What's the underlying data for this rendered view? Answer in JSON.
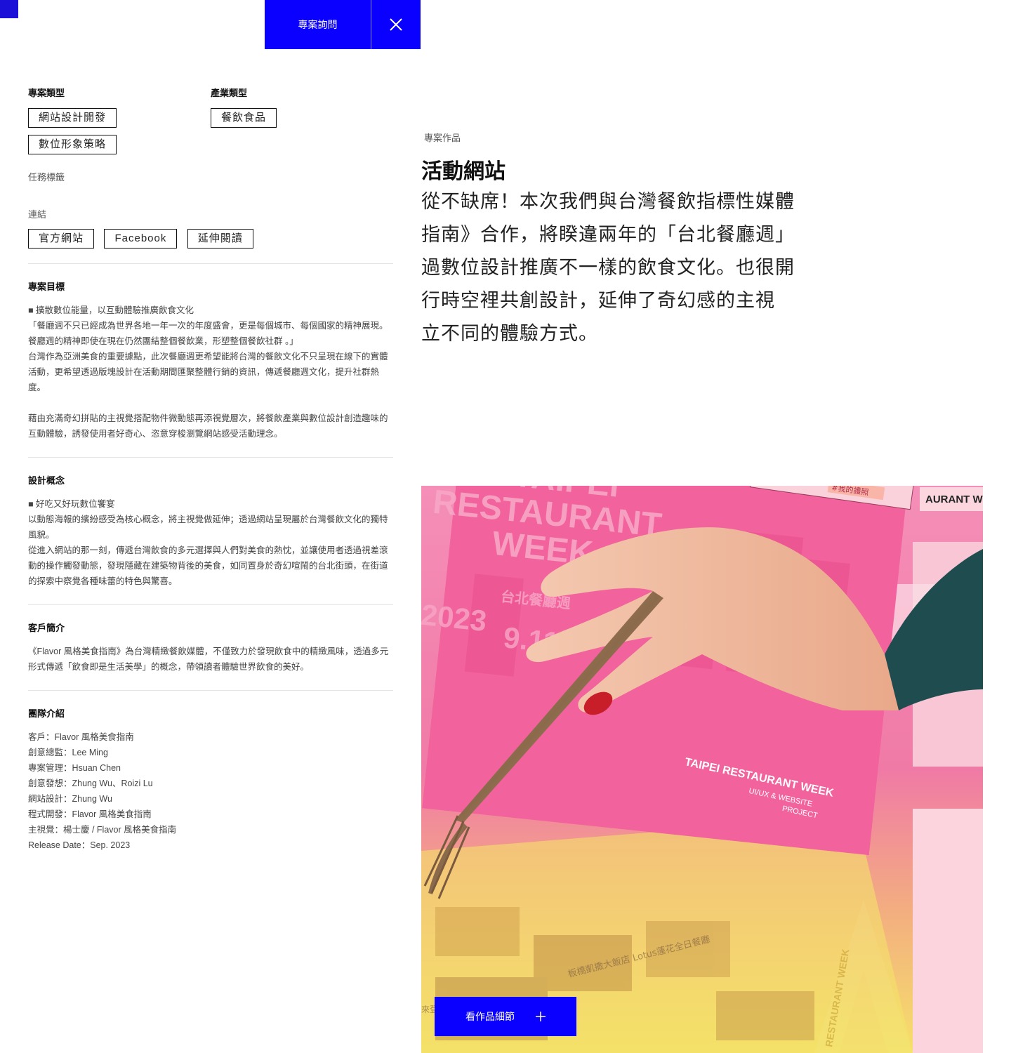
{
  "nav": {
    "inquiry_label": "專案詢問",
    "close_icon": "close-icon"
  },
  "meta": {
    "project_type_label": "專案類型",
    "project_types": [
      "網站設計開發",
      "數位形象策略"
    ],
    "industry_label": "產業類型",
    "industries": [
      "餐飲食品"
    ],
    "task_tags_label": "任務標籤",
    "links_label": "連結",
    "links": [
      "官方網站",
      "Facebook",
      "延伸閱讀"
    ]
  },
  "goal": {
    "title": "專案目標",
    "bullet": "■ 擴散數位能量，以互動體驗推廣飲食文化",
    "lines": [
      "「餐廳週不只已經成為世界各地一年一次的年度盛會，更是每個城市、每個國家的精神展現。餐廳週的精神即使在現在仍然團結整個餐飲業，形塑整個餐飲社群 。」",
      "台灣作為亞洲美食的重要據點，此次餐廳週更希望能將台灣的餐飲文化不只呈現在線下的實體活動，更希望透過版塊設計在活動期間匯聚整體行銷的資訊，傳遞餐廳週文化，提升社群熱度。"
    ],
    "closing": "藉由充滿奇幻拼貼的主視覺搭配物件微動態再添視覺層次，將餐飲產業與數位設計創造趣味的互動體驗，誘發使用者好奇心、恣意穿梭瀏覽網站感受活動理念。"
  },
  "concept": {
    "title": "設計概念",
    "bullet": "■ 好吃又好玩數位饗宴",
    "lines": [
      "以動態海報的繽紛感受為核心概念，將主視覺做延伸；透過網站呈現屬於台灣餐飲文化的獨特風貌。",
      "從進入網站的那一刻，傳遞台灣飲食的多元選擇與人們對美食的熱忱，並讓使用者透過視差滾動的操作觸發動態，發現隱藏在建築物背後的美食，如同置身於奇幻喧鬧的台北街頭，在街道的探索中察覺各種味蕾的特色與驚喜。"
    ]
  },
  "client": {
    "title": "客戶簡介",
    "text": "《Flavor 風格美食指南》為台灣精緻餐飲媒體，不僅致力於發現飲食中的精緻風味，透過多元形式傳遞「飲食即是生活美學」的概念，帶領讀者體驗世界飲食的美好。"
  },
  "team": {
    "title": "團隊介紹",
    "lines": [
      "客戶：Flavor 風格美食指南",
      "創意總監：Lee Ming",
      "專案管理：Hsuan Chen",
      "創意發想：Zhung Wu、Roizi Lu",
      "網站設計：Zhung Wu",
      "程式開發：Flavor 風格美食指南",
      "主視覺：楊士慶 / Flavor 風格美食指南",
      "Release Date：Sep. 2023"
    ]
  },
  "work": {
    "eyebrow": "專案作品",
    "headline": "活動網站",
    "lead_lines": [
      "從不缺席！本次我們與台灣餐飲指標性媒體",
      "指南》合作，將睽違兩年的「台北餐廳週」",
      "過數位設計推廣不一樣的飲食文化。也很開",
      "行時空裡共創設計，延伸了奇幻感的主視",
      "立不同的體驗方式。"
    ]
  },
  "hero": {
    "texts": {
      "taipei": "TAIPEI",
      "restaurant": "RESTAURANT",
      "week": "WEEK",
      "badge": "#我的護照",
      "side": "AURANT W",
      "year": "2023",
      "date": "9.11—",
      "cn_title": "台北餐廳週",
      "poster_title": "TAIPEI RESTAURANT WEEK",
      "poster_sub1": "UI/UX & WEBSITE",
      "poster_sub2": "PROJECT",
      "hotel": "板橋凱撒大飯店 Lotus蓮花全日餐廳",
      "menu": "來登",
      "vertical": "RESTAURANT WEEK"
    }
  },
  "cta": {
    "label": "看作品細節",
    "icon": "plus-icon"
  },
  "colors": {
    "brand_blue": "#0a00ff",
    "hero_pink": "#f07aa8",
    "hero_yellow": "#f5dc6a"
  }
}
